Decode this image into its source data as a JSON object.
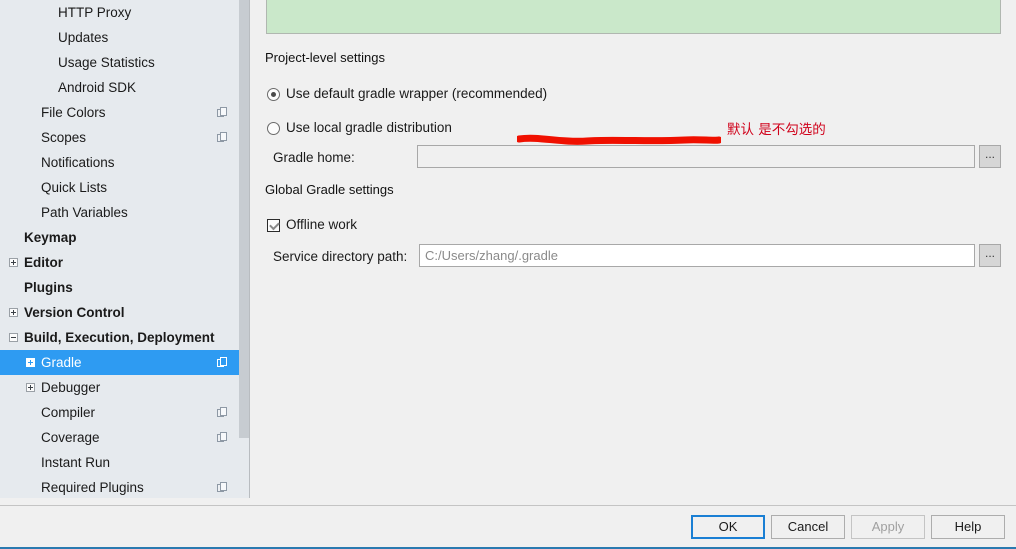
{
  "sidebar": {
    "items": [
      {
        "label": "HTTP Proxy",
        "depth": 3,
        "bold": false,
        "expander": null,
        "copy_icon": false,
        "selected": false
      },
      {
        "label": "Updates",
        "depth": 3,
        "bold": false,
        "expander": null,
        "copy_icon": false,
        "selected": false
      },
      {
        "label": "Usage Statistics",
        "depth": 3,
        "bold": false,
        "expander": null,
        "copy_icon": false,
        "selected": false
      },
      {
        "label": "Android SDK",
        "depth": 3,
        "bold": false,
        "expander": null,
        "copy_icon": false,
        "selected": false
      },
      {
        "label": "File Colors",
        "depth": 2,
        "bold": false,
        "expander": null,
        "copy_icon": true,
        "selected": false
      },
      {
        "label": "Scopes",
        "depth": 2,
        "bold": false,
        "expander": null,
        "copy_icon": true,
        "selected": false
      },
      {
        "label": "Notifications",
        "depth": 2,
        "bold": false,
        "expander": null,
        "copy_icon": false,
        "selected": false
      },
      {
        "label": "Quick Lists",
        "depth": 2,
        "bold": false,
        "expander": null,
        "copy_icon": false,
        "selected": false
      },
      {
        "label": "Path Variables",
        "depth": 2,
        "bold": false,
        "expander": null,
        "copy_icon": false,
        "selected": false
      },
      {
        "label": "Keymap",
        "depth": 1,
        "bold": true,
        "expander": null,
        "copy_icon": false,
        "selected": false
      },
      {
        "label": "Editor",
        "depth": 1,
        "bold": true,
        "expander": "plus",
        "copy_icon": false,
        "selected": false
      },
      {
        "label": "Plugins",
        "depth": 1,
        "bold": true,
        "expander": null,
        "copy_icon": false,
        "selected": false
      },
      {
        "label": "Version Control",
        "depth": 1,
        "bold": true,
        "expander": "plus",
        "copy_icon": false,
        "selected": false
      },
      {
        "label": "Build, Execution, Deployment",
        "depth": 1,
        "bold": true,
        "expander": "minus",
        "copy_icon": false,
        "selected": false
      },
      {
        "label": "Gradle",
        "depth": 2,
        "bold": false,
        "expander": "plus",
        "copy_icon": true,
        "selected": true
      },
      {
        "label": "Debugger",
        "depth": 2,
        "bold": false,
        "expander": "plus",
        "copy_icon": false,
        "selected": false
      },
      {
        "label": "Compiler",
        "depth": 2,
        "bold": false,
        "expander": null,
        "copy_icon": true,
        "selected": false
      },
      {
        "label": "Coverage",
        "depth": 2,
        "bold": false,
        "expander": null,
        "copy_icon": true,
        "selected": false
      },
      {
        "label": "Instant Run",
        "depth": 2,
        "bold": false,
        "expander": null,
        "copy_icon": false,
        "selected": false
      },
      {
        "label": "Required Plugins",
        "depth": 2,
        "bold": false,
        "expander": null,
        "copy_icon": true,
        "selected": false
      }
    ]
  },
  "main": {
    "project_section": {
      "title": "Project-level settings",
      "radio_wrapper": {
        "label": "Use default gradle wrapper (recommended)",
        "selected": true
      },
      "radio_local": {
        "label": "Use local gradle distribution",
        "selected": false
      },
      "gradle_home": {
        "label": "Gradle home:",
        "value": "",
        "browse_label": "...",
        "enabled": false
      }
    },
    "global_section": {
      "title": "Global Gradle settings",
      "offline_work": {
        "label": "Offline work",
        "checked": true
      },
      "service_dir": {
        "label": "Service directory path:",
        "value": "C:/Users/zhang/.gradle",
        "browse_label": "...",
        "enabled": true
      }
    },
    "annotation": {
      "text": "默认 是不勾选的",
      "color": "#d0021b"
    }
  },
  "footer": {
    "ok_label": "OK",
    "cancel_label": "Cancel",
    "apply_label": "Apply",
    "help_label": "Help",
    "apply_enabled": false
  },
  "colors": {
    "selection_blue": "#2e9bf2",
    "notice_green": "#cae8ca",
    "panel_gray": "#f0f0f0",
    "sidebar_gray": "#e6eaee",
    "annotation_red": "#d0021b",
    "focus_blue": "#1a7fd4"
  }
}
